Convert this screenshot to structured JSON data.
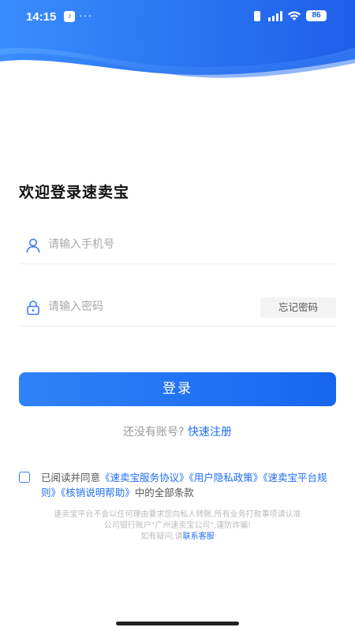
{
  "status_bar": {
    "time": "14:15",
    "app_badge": "♪",
    "dots": "···",
    "battery": "86"
  },
  "login": {
    "welcome": "欢迎登录速卖宝",
    "phone_placeholder": "请输入手机号",
    "password_placeholder": "请输入密码",
    "forgot_password": "忘记密码",
    "login_button": "登录",
    "no_account": "还没有账号?",
    "register_link": "快速注册"
  },
  "agreement": {
    "prefix": "已阅读并同意",
    "links": [
      "《速卖宝服务协议》",
      "《用户隐私政策》",
      "《速卖宝平台规则》",
      "《核销说明帮助》"
    ],
    "suffix": "中的全部条款"
  },
  "notice": {
    "line1": "速卖宝平台不会以任何理由要求您向私人转账,所有业务打款事项请认准",
    "line2": "公司银行账户\"广州速卖宝公司\",谨防诈骗!",
    "line3_prefix": "如有疑问,请",
    "line3_link": "联系客服"
  },
  "colors": {
    "accent": "#1f6ff0",
    "hero_gradient_start": "#3a8dfd",
    "hero_gradient_end": "#1e5fe8"
  },
  "icons": {
    "phone_field": "user-icon",
    "password_field": "lock-icon"
  }
}
